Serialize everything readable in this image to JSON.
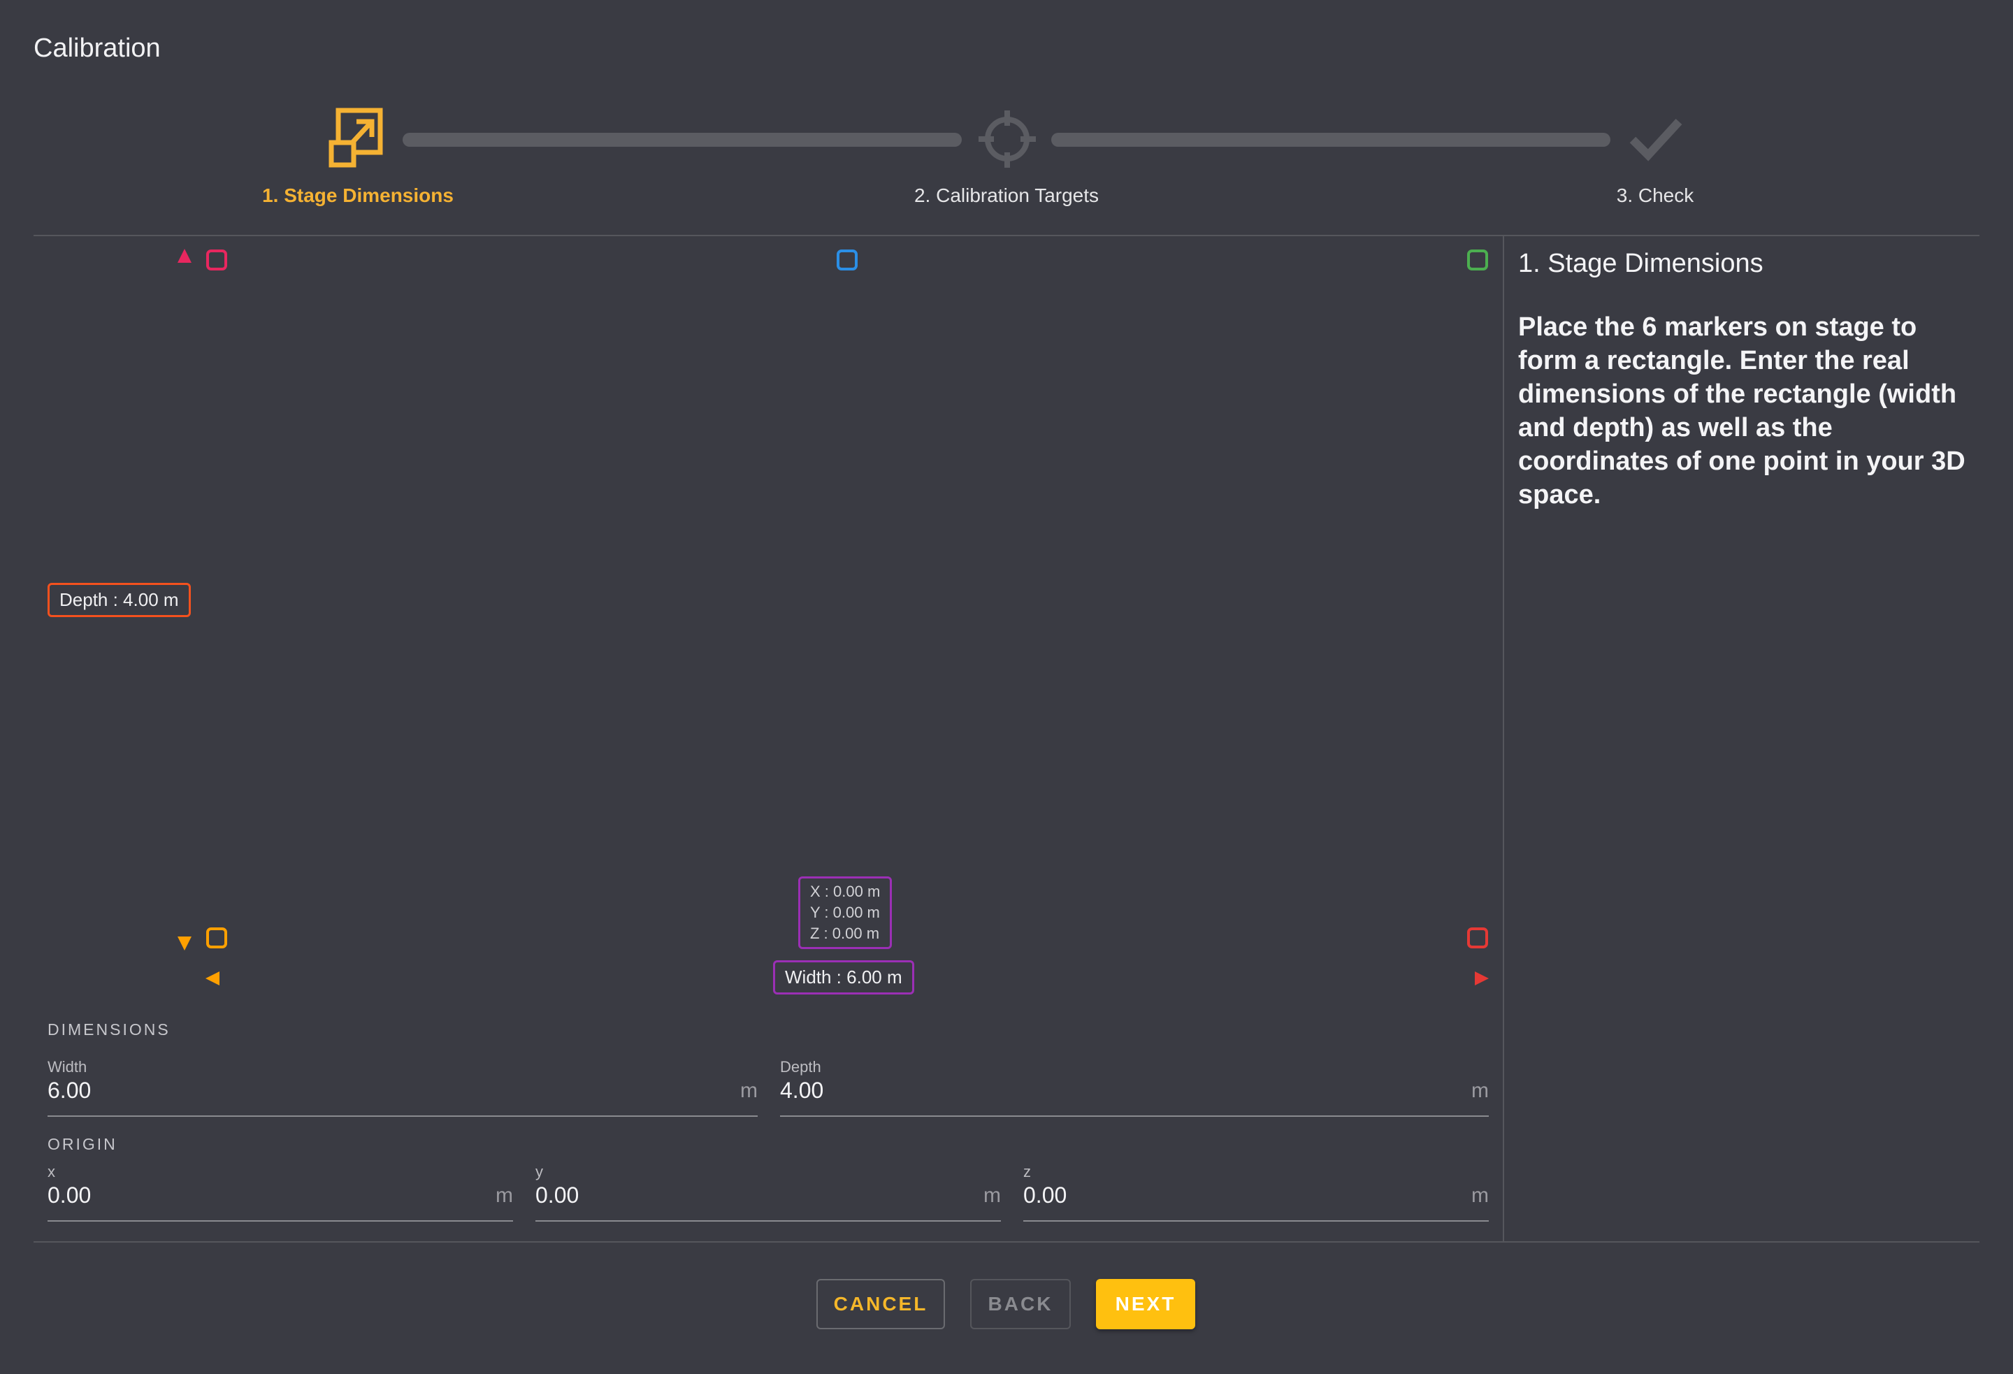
{
  "window": {
    "title": "Calibration"
  },
  "stepper": {
    "steps": [
      {
        "label": "1. Stage Dimensions",
        "icon": "resize-icon",
        "state": "active"
      },
      {
        "label": "2. Calibration Targets",
        "icon": "crosshair-icon",
        "state": "inactive"
      },
      {
        "label": "3. Check",
        "icon": "check-icon",
        "state": "inactive"
      }
    ],
    "active_color": "#f5b233",
    "inactive_color": "#5b5c62"
  },
  "diagram": {
    "depth_label": "Depth : 4.00 m",
    "width_label": "Width : 6.00 m",
    "origin": {
      "x": "X : 0.00 m",
      "y": "Y : 0.00 m",
      "z": "Z : 0.00 m"
    },
    "marker_colors": [
      "#e8275f",
      "#2b8fe6",
      "#4caf50",
      "#ffa000",
      "#e53935"
    ]
  },
  "dimensions": {
    "section_label": "DIMENSIONS",
    "width": {
      "label": "Width",
      "value": "6.00",
      "unit": "m"
    },
    "depth": {
      "label": "Depth",
      "value": "4.00",
      "unit": "m"
    }
  },
  "origin": {
    "section_label": "ORIGIN",
    "x": {
      "label": "x",
      "value": "0.00",
      "unit": "m"
    },
    "y": {
      "label": "y",
      "value": "0.00",
      "unit": "m"
    },
    "z": {
      "label": "z",
      "value": "0.00",
      "unit": "m"
    }
  },
  "side_panel": {
    "title": "1. Stage Dimensions",
    "text": "Place the 6 markers on stage to form a rectangle. Enter the real dimensions of the rectangle (width and depth) as well as the coordinates of one point in your 3D space."
  },
  "footer": {
    "cancel_label": "CANCEL",
    "back_label": "BACK",
    "next_label": "NEXT"
  }
}
